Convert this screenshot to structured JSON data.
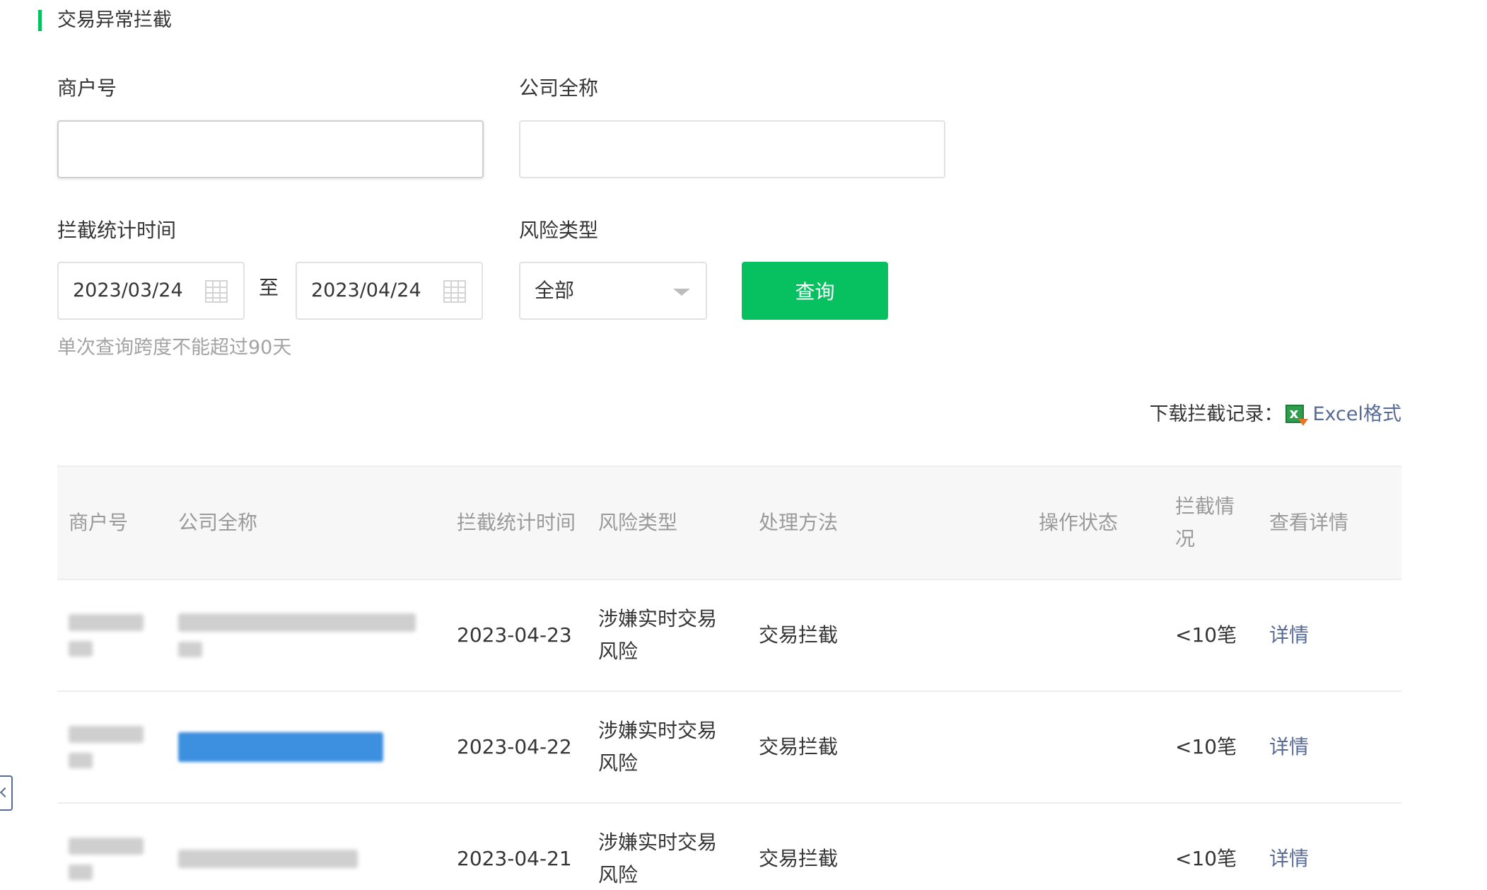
{
  "page": {
    "title": "交易异常拦截"
  },
  "form": {
    "merchant_label": "商户号",
    "merchant_value": "",
    "company_label": "公司全称",
    "company_value": "",
    "time_label": "拦截统计时间",
    "start_date": "2023/03/24",
    "separator": "至",
    "end_date": "2023/04/24",
    "risk_label": "风险类型",
    "risk_selected": "全部",
    "query_label": "查询",
    "hint": "单次查询跨度不能超过90天"
  },
  "download": {
    "label": "下载拦截记录：",
    "link": "Excel格式"
  },
  "table": {
    "headers": [
      "商户号",
      "公司全称",
      "拦截统计时间",
      "风险类型",
      "处理方法",
      "操作状态",
      "拦截情况",
      "查看详情"
    ],
    "rows": [
      {
        "merchant": "",
        "company": "",
        "time": "2023-04-23",
        "risk": "涉嫌实时交易风险",
        "method": "交易拦截",
        "status": "",
        "situation": "<10笔",
        "detail": "详情"
      },
      {
        "merchant": "",
        "company": "",
        "time": "2023-04-22",
        "risk": "涉嫌实时交易风险",
        "method": "交易拦截",
        "status": "",
        "situation": "<10笔",
        "detail": "详情"
      },
      {
        "merchant": "",
        "company": "",
        "time": "2023-04-21",
        "risk": "涉嫌实时交易风险",
        "method": "交易拦截",
        "status": "",
        "situation": "<10笔",
        "detail": "详情"
      }
    ]
  },
  "colors": {
    "accent_green": "#07c160",
    "link_blue": "#576b95",
    "redaction_blue": "#3d8fe0"
  },
  "icons": {
    "calendar": "calendar-icon",
    "dropdown": "chevron-down-icon",
    "excel": "excel-file-icon",
    "side_collapse": "chevron-left-icon"
  }
}
